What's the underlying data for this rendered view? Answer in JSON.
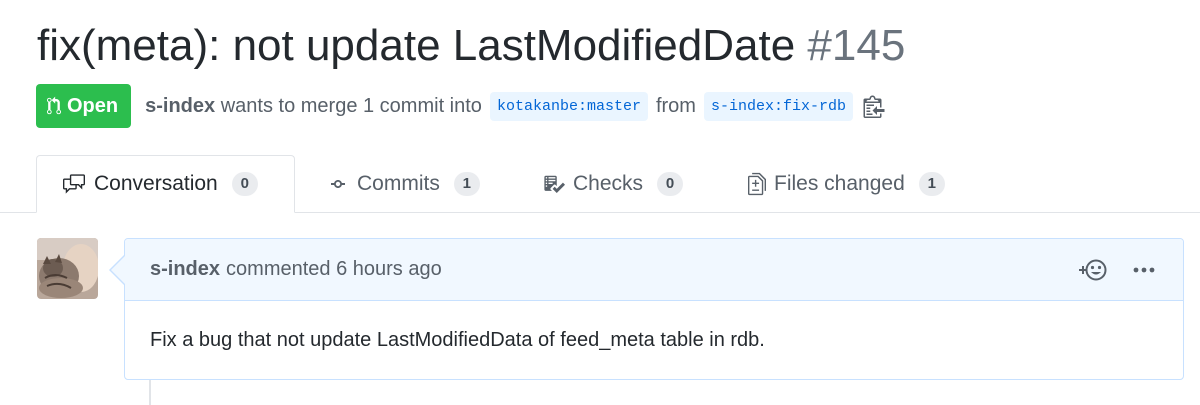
{
  "pr": {
    "title": "fix(meta): not update LastModifiedDate",
    "number": "#145",
    "state": "Open",
    "author": "s-index",
    "merge_text": "wants to merge 1 commit into",
    "base_branch": "kotakanbe:master",
    "from_text": "from",
    "head_branch": "s-index:fix-rdb"
  },
  "tabs": [
    {
      "label": "Conversation",
      "count": "0",
      "icon": "comment-discussion-icon",
      "selected": true
    },
    {
      "label": "Commits",
      "count": "1",
      "icon": "git-commit-icon"
    },
    {
      "label": "Checks",
      "count": "0",
      "icon": "checklist-icon"
    },
    {
      "label": "Files changed",
      "count": "1",
      "icon": "file-diff-icon"
    }
  ],
  "comment": {
    "author": "s-index",
    "action": "commented 6 hours ago",
    "body": "Fix a bug that not update LastModifiedData of feed_meta table in rdb."
  },
  "colors": {
    "open_green": "#2cbe4e",
    "link_blue": "#0366d6",
    "comment_header_bg": "#f1f8ff",
    "comment_border": "#c8e1ff"
  }
}
